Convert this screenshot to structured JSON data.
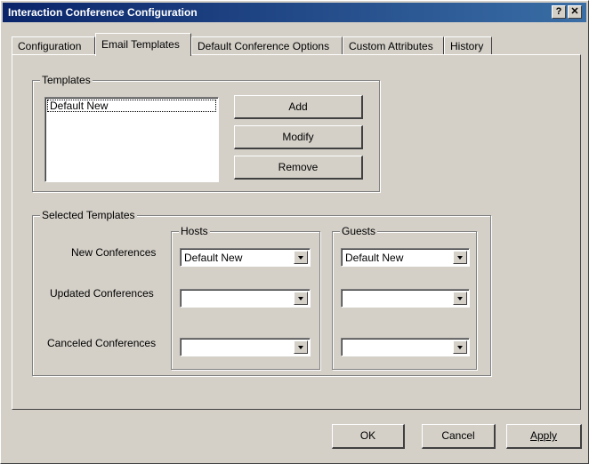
{
  "window": {
    "title": "Interaction Conference Configuration",
    "help_label": "?",
    "close_label": "✕"
  },
  "tabs": [
    {
      "label": "Configuration"
    },
    {
      "label": "Email Templates"
    },
    {
      "label": "Default Conference Options"
    },
    {
      "label": "Custom Attributes"
    },
    {
      "label": "History"
    }
  ],
  "active_tab": "Email Templates",
  "templates": {
    "legend": "Templates",
    "items": [
      "Default New"
    ],
    "add_label": "Add",
    "modify_label": "Modify",
    "remove_label": "Remove"
  },
  "selected": {
    "legend": "Selected Templates",
    "hosts_legend": "Hosts",
    "guests_legend": "Guests",
    "rows": [
      {
        "label": "New Conferences",
        "host": "Default New",
        "guest": "Default New"
      },
      {
        "label": "Updated Conferences",
        "host": "",
        "guest": ""
      },
      {
        "label": "Canceled Conferences",
        "host": "",
        "guest": ""
      }
    ]
  },
  "footer": {
    "ok_label": "OK",
    "cancel_label": "Cancel",
    "apply_label": "Apply"
  }
}
